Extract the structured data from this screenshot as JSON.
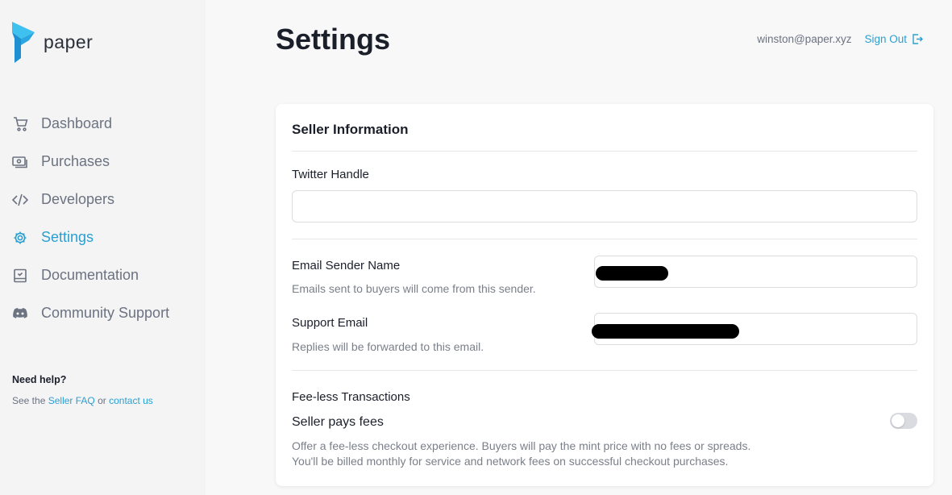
{
  "brand": {
    "name": "paper",
    "accent": "#2a9fd0"
  },
  "sidebar": {
    "items": [
      {
        "label": "Dashboard",
        "icon": "cart-icon"
      },
      {
        "label": "Purchases",
        "icon": "cash-icon"
      },
      {
        "label": "Developers",
        "icon": "code-icon"
      },
      {
        "label": "Settings",
        "icon": "gear-icon",
        "active": true
      },
      {
        "label": "Documentation",
        "icon": "book-icon"
      },
      {
        "label": "Community Support",
        "icon": "discord-icon"
      }
    ],
    "help": {
      "title": "Need help?",
      "prefix": "See the",
      "faq_link": "Seller FAQ",
      "or": "or",
      "contact_link": "contact us"
    }
  },
  "header": {
    "title": "Settings",
    "email": "winston@paper.xyz",
    "sign_out": "Sign Out"
  },
  "seller_info": {
    "title": "Seller Information",
    "twitter_label": "Twitter Handle",
    "twitter_value": "",
    "sender_name_label": "Email Sender Name",
    "sender_name_hint": "Emails sent to buyers will come from this sender.",
    "support_email_label": "Support Email",
    "support_email_hint": "Replies will be forwarded to this email.",
    "feeless_label": "Fee-less Transactions",
    "seller_pays_label": "Seller pays fees",
    "seller_pays_enabled": false,
    "feeless_hint_1": "Offer a fee-less checkout experience. Buyers will pay the mint price with no fees or spreads.",
    "feeless_hint_2": "You'll be billed monthly for service and network fees on successful checkout purchases."
  }
}
